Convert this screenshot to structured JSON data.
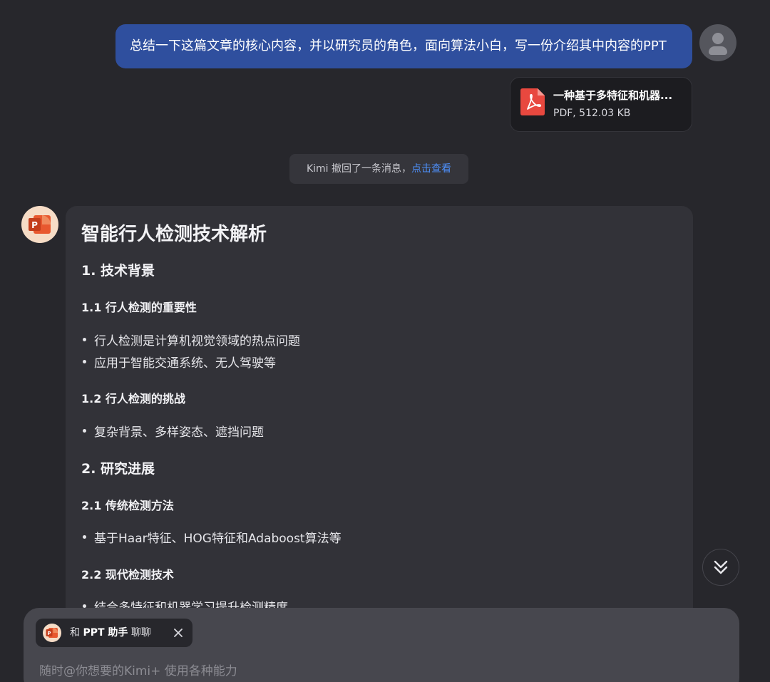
{
  "user_message": {
    "text": "总结一下这篇文章的核心内容，并以研究员的角色，面向算法小白，写一份介绍其中内容的PPT",
    "avatar_icon": "user-avatar-icon"
  },
  "attachment": {
    "file_name": "一种基于多特征和机器...",
    "file_meta": "PDF, 512.03 KB",
    "icon": "pdf-icon",
    "icon_color": "#e8483f"
  },
  "recall_notice": {
    "text": "Kimi 撤回了一条消息，",
    "link": "点击查看",
    "link_color": "#4d8ef7"
  },
  "assistant_message": {
    "avatar_icon": "powerpoint-icon",
    "title": "智能行人检测技术解析",
    "sections": [
      {
        "heading": "1. 技术背景",
        "subsections": [
          {
            "heading": "1.1 行人检测的重要性",
            "bullets": [
              "行人检测是计算机视觉领域的热点问题",
              "应用于智能交通系统、无人驾驶等"
            ]
          },
          {
            "heading": "1.2 行人检测的挑战",
            "bullets": [
              "复杂背景、多样姿态、遮挡问题"
            ]
          }
        ]
      },
      {
        "heading": "2. 研究进展",
        "subsections": [
          {
            "heading": "2.1 传统检测方法",
            "bullets": [
              "基于Haar特征、HOG特征和Adaboost算法等"
            ]
          },
          {
            "heading": "2.2 现代检测技术",
            "bullets": [
              "结合多特征和机器学习提升检测精度"
            ]
          }
        ]
      }
    ]
  },
  "scroll_button": {
    "icon": "double-chevron-down-icon"
  },
  "input_area": {
    "chip": {
      "prefix": "和",
      "name": "PPT 助手",
      "suffix": "聊聊",
      "icon": "powerpoint-icon",
      "close_icon": "close-icon"
    },
    "placeholder": "随时@你想要的Kimi+ 使用各种能力"
  }
}
